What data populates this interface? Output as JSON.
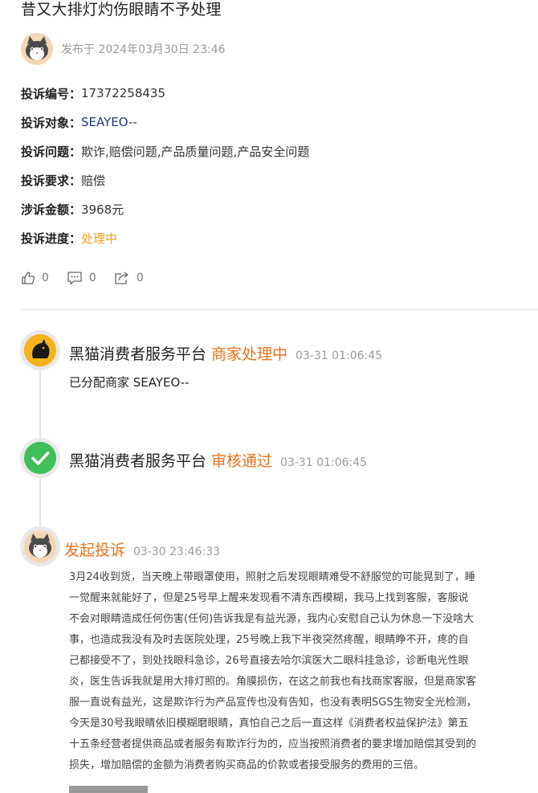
{
  "title": "昔又大排灯灼伤眼睛不予处理",
  "author": {
    "published": "发布于 2024年03月30日 23:46"
  },
  "fields": [
    {
      "key": "投诉编号：",
      "value": "17372258435",
      "style": "plain"
    },
    {
      "key": "投诉对象：",
      "value": "SEAYEO--",
      "style": "link"
    },
    {
      "key": "投诉问题：",
      "value": "欺诈,赔偿问题,产品质量问题,产品安全问题",
      "style": "plain"
    },
    {
      "key": "投诉要求：",
      "value": "赔偿",
      "style": "plain"
    },
    {
      "key": "涉诉金额：",
      "value": "3968元",
      "style": "plain"
    },
    {
      "key": "投诉进度：",
      "value": "处理中",
      "style": "orange"
    }
  ],
  "actions": {
    "like_count": "0",
    "comment_count": "0",
    "share_count": "0"
  },
  "timeline": [
    {
      "name": "黑猫消费者服务平台",
      "status": "商家处理中",
      "time": "03-31 01:06:45",
      "body": "已分配商家 SEAYEO--"
    },
    {
      "name": "黑猫消费者服务平台",
      "status": "审核通过",
      "time": "03-31 01:06:45"
    },
    {
      "name": "",
      "status": "发起投诉",
      "time": "03-30 23:46:33"
    }
  ],
  "complaint_lines": [
    "3月24收到货，当天晚上带眼罩使用，照射之后发现眼睛难受不舒服觉的可能晃到了，睡",
    "一觉醒来就能好了，但是25号早上醒来发现看不清东西模糊，我马上找到客服，客服说",
    "不会对眼睛造成任何伤害(任何)告诉我是有益光源，我内心安慰自己认为休息一下没啥大",
    "事，也造成我没有及时去医院处理，25号晚上我下半夜突然疼醒，眼睛睁不开，疼的自",
    "己都接受不了，到处找眼科急诊，26号直接去哈尔滨医大二眼科挂急诊，诊断电光性眼",
    "炎，医生告诉我就是用大排灯照的。角膜损伤，在这之前我也有找商家客服，但是商家客",
    "服一直说有益光，这是欺诈行为产品宣传也没有告知，也没有表明SGS生物安全光检测，",
    "今天是30号我眼睛依旧模糊磨眼睛，真怕自己之后一直这样《消费者权益保护法》第五",
    "十五条经营者提供商品或者服务有欺诈行为的，应当按照消费者的要求增加赔偿其受到的",
    "损失，增加赔偿的金额为消费者购买商品的价款或者接受服务的费用的三倍。"
  ],
  "colors": {
    "accent_orange": "#f07018",
    "progress_orange": "#f0a020",
    "link_blue": "#1f3b7a",
    "check_green": "#3fbf5a"
  }
}
